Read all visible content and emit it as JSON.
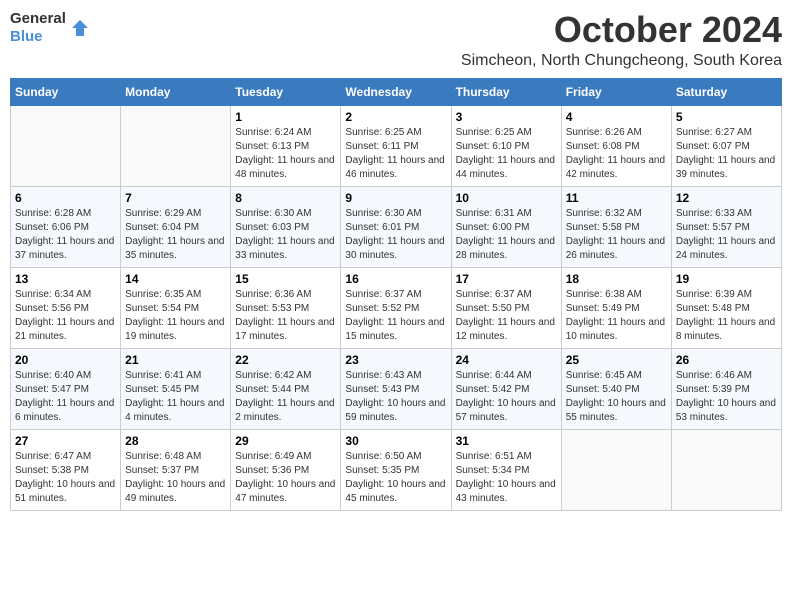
{
  "logo": {
    "general": "General",
    "blue": "Blue"
  },
  "header": {
    "month": "October 2024",
    "location": "Simcheon, North Chungcheong, South Korea"
  },
  "days_of_week": [
    "Sunday",
    "Monday",
    "Tuesday",
    "Wednesday",
    "Thursday",
    "Friday",
    "Saturday"
  ],
  "weeks": [
    [
      {
        "day": "",
        "sunrise": "",
        "sunset": "",
        "daylight": ""
      },
      {
        "day": "",
        "sunrise": "",
        "sunset": "",
        "daylight": ""
      },
      {
        "day": "1",
        "sunrise": "Sunrise: 6:24 AM",
        "sunset": "Sunset: 6:13 PM",
        "daylight": "Daylight: 11 hours and 48 minutes."
      },
      {
        "day": "2",
        "sunrise": "Sunrise: 6:25 AM",
        "sunset": "Sunset: 6:11 PM",
        "daylight": "Daylight: 11 hours and 46 minutes."
      },
      {
        "day": "3",
        "sunrise": "Sunrise: 6:25 AM",
        "sunset": "Sunset: 6:10 PM",
        "daylight": "Daylight: 11 hours and 44 minutes."
      },
      {
        "day": "4",
        "sunrise": "Sunrise: 6:26 AM",
        "sunset": "Sunset: 6:08 PM",
        "daylight": "Daylight: 11 hours and 42 minutes."
      },
      {
        "day": "5",
        "sunrise": "Sunrise: 6:27 AM",
        "sunset": "Sunset: 6:07 PM",
        "daylight": "Daylight: 11 hours and 39 minutes."
      }
    ],
    [
      {
        "day": "6",
        "sunrise": "Sunrise: 6:28 AM",
        "sunset": "Sunset: 6:06 PM",
        "daylight": "Daylight: 11 hours and 37 minutes."
      },
      {
        "day": "7",
        "sunrise": "Sunrise: 6:29 AM",
        "sunset": "Sunset: 6:04 PM",
        "daylight": "Daylight: 11 hours and 35 minutes."
      },
      {
        "day": "8",
        "sunrise": "Sunrise: 6:30 AM",
        "sunset": "Sunset: 6:03 PM",
        "daylight": "Daylight: 11 hours and 33 minutes."
      },
      {
        "day": "9",
        "sunrise": "Sunrise: 6:30 AM",
        "sunset": "Sunset: 6:01 PM",
        "daylight": "Daylight: 11 hours and 30 minutes."
      },
      {
        "day": "10",
        "sunrise": "Sunrise: 6:31 AM",
        "sunset": "Sunset: 6:00 PM",
        "daylight": "Daylight: 11 hours and 28 minutes."
      },
      {
        "day": "11",
        "sunrise": "Sunrise: 6:32 AM",
        "sunset": "Sunset: 5:58 PM",
        "daylight": "Daylight: 11 hours and 26 minutes."
      },
      {
        "day": "12",
        "sunrise": "Sunrise: 6:33 AM",
        "sunset": "Sunset: 5:57 PM",
        "daylight": "Daylight: 11 hours and 24 minutes."
      }
    ],
    [
      {
        "day": "13",
        "sunrise": "Sunrise: 6:34 AM",
        "sunset": "Sunset: 5:56 PM",
        "daylight": "Daylight: 11 hours and 21 minutes."
      },
      {
        "day": "14",
        "sunrise": "Sunrise: 6:35 AM",
        "sunset": "Sunset: 5:54 PM",
        "daylight": "Daylight: 11 hours and 19 minutes."
      },
      {
        "day": "15",
        "sunrise": "Sunrise: 6:36 AM",
        "sunset": "Sunset: 5:53 PM",
        "daylight": "Daylight: 11 hours and 17 minutes."
      },
      {
        "day": "16",
        "sunrise": "Sunrise: 6:37 AM",
        "sunset": "Sunset: 5:52 PM",
        "daylight": "Daylight: 11 hours and 15 minutes."
      },
      {
        "day": "17",
        "sunrise": "Sunrise: 6:37 AM",
        "sunset": "Sunset: 5:50 PM",
        "daylight": "Daylight: 11 hours and 12 minutes."
      },
      {
        "day": "18",
        "sunrise": "Sunrise: 6:38 AM",
        "sunset": "Sunset: 5:49 PM",
        "daylight": "Daylight: 11 hours and 10 minutes."
      },
      {
        "day": "19",
        "sunrise": "Sunrise: 6:39 AM",
        "sunset": "Sunset: 5:48 PM",
        "daylight": "Daylight: 11 hours and 8 minutes."
      }
    ],
    [
      {
        "day": "20",
        "sunrise": "Sunrise: 6:40 AM",
        "sunset": "Sunset: 5:47 PM",
        "daylight": "Daylight: 11 hours and 6 minutes."
      },
      {
        "day": "21",
        "sunrise": "Sunrise: 6:41 AM",
        "sunset": "Sunset: 5:45 PM",
        "daylight": "Daylight: 11 hours and 4 minutes."
      },
      {
        "day": "22",
        "sunrise": "Sunrise: 6:42 AM",
        "sunset": "Sunset: 5:44 PM",
        "daylight": "Daylight: 11 hours and 2 minutes."
      },
      {
        "day": "23",
        "sunrise": "Sunrise: 6:43 AM",
        "sunset": "Sunset: 5:43 PM",
        "daylight": "Daylight: 10 hours and 59 minutes."
      },
      {
        "day": "24",
        "sunrise": "Sunrise: 6:44 AM",
        "sunset": "Sunset: 5:42 PM",
        "daylight": "Daylight: 10 hours and 57 minutes."
      },
      {
        "day": "25",
        "sunrise": "Sunrise: 6:45 AM",
        "sunset": "Sunset: 5:40 PM",
        "daylight": "Daylight: 10 hours and 55 minutes."
      },
      {
        "day": "26",
        "sunrise": "Sunrise: 6:46 AM",
        "sunset": "Sunset: 5:39 PM",
        "daylight": "Daylight: 10 hours and 53 minutes."
      }
    ],
    [
      {
        "day": "27",
        "sunrise": "Sunrise: 6:47 AM",
        "sunset": "Sunset: 5:38 PM",
        "daylight": "Daylight: 10 hours and 51 minutes."
      },
      {
        "day": "28",
        "sunrise": "Sunrise: 6:48 AM",
        "sunset": "Sunset: 5:37 PM",
        "daylight": "Daylight: 10 hours and 49 minutes."
      },
      {
        "day": "29",
        "sunrise": "Sunrise: 6:49 AM",
        "sunset": "Sunset: 5:36 PM",
        "daylight": "Daylight: 10 hours and 47 minutes."
      },
      {
        "day": "30",
        "sunrise": "Sunrise: 6:50 AM",
        "sunset": "Sunset: 5:35 PM",
        "daylight": "Daylight: 10 hours and 45 minutes."
      },
      {
        "day": "31",
        "sunrise": "Sunrise: 6:51 AM",
        "sunset": "Sunset: 5:34 PM",
        "daylight": "Daylight: 10 hours and 43 minutes."
      },
      {
        "day": "",
        "sunrise": "",
        "sunset": "",
        "daylight": ""
      },
      {
        "day": "",
        "sunrise": "",
        "sunset": "",
        "daylight": ""
      }
    ]
  ]
}
